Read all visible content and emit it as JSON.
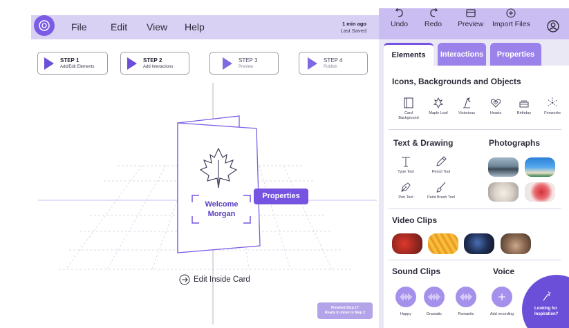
{
  "menu": {
    "file": "File",
    "edit": "Edit",
    "view": "View",
    "help": "Help"
  },
  "save_status": {
    "time": "1 min ago",
    "label": "Last Saved"
  },
  "toolbar": {
    "undo": "Undo",
    "redo": "Redo",
    "preview": "Preview",
    "import": "Import Files"
  },
  "steps": [
    {
      "title": "STEP 1",
      "subtitle": "Add/Edit Elements"
    },
    {
      "title": "STEP 2",
      "subtitle": "Add Interactions"
    },
    {
      "title": "STEP 3",
      "subtitle": "Preview"
    },
    {
      "title": "STEP 4",
      "subtitle": "Publish"
    }
  ],
  "card": {
    "line1": "Welcome",
    "line2": "Morgan"
  },
  "properties_button": "Properties",
  "edit_inside": "Edit Inside Card",
  "finished": {
    "line1": "Finished Step 1?",
    "line2": "Ready to move to Step 2"
  },
  "panel": {
    "tabs": [
      "Elements",
      "Interactions",
      "Properties"
    ],
    "icons_section": "Icons, Backgrounds and Objects",
    "icon_items": [
      {
        "label": "Card Background",
        "icon": "card-background-icon"
      },
      {
        "label": "Maple Leaf",
        "icon": "maple-leaf-icon"
      },
      {
        "label": "Victorious",
        "icon": "victorious-icon"
      },
      {
        "label": "Hearts",
        "icon": "hearts-icon"
      },
      {
        "label": "Birthday",
        "icon": "birthday-icon"
      },
      {
        "label": "Fireworks",
        "icon": "fireworks-icon"
      }
    ],
    "text_section": "Text & Drawing",
    "text_tools": [
      {
        "label": "Type Tool",
        "icon": "type-tool-icon"
      },
      {
        "label": "Pencil Tool",
        "icon": "pencil-tool-icon"
      },
      {
        "label": "Pen Tool",
        "icon": "pen-tool-icon"
      },
      {
        "label": "Paint Brush Tool",
        "icon": "paint-brush-icon"
      }
    ],
    "photos_section": "Photographs",
    "video_section": "Video Clips",
    "sound_section": "Sound Clips",
    "sound_items": [
      "Happy",
      "Dramatic",
      "Romantic"
    ],
    "voice_section": "Voice",
    "voice_item": "Add recording",
    "inspiration": {
      "line1": "Looking for",
      "line2": "Inspiration?"
    }
  },
  "colors": {
    "accent": "#7653e0",
    "panel_bg": "#ebe8f6",
    "topbar": "#d9d1f4"
  }
}
